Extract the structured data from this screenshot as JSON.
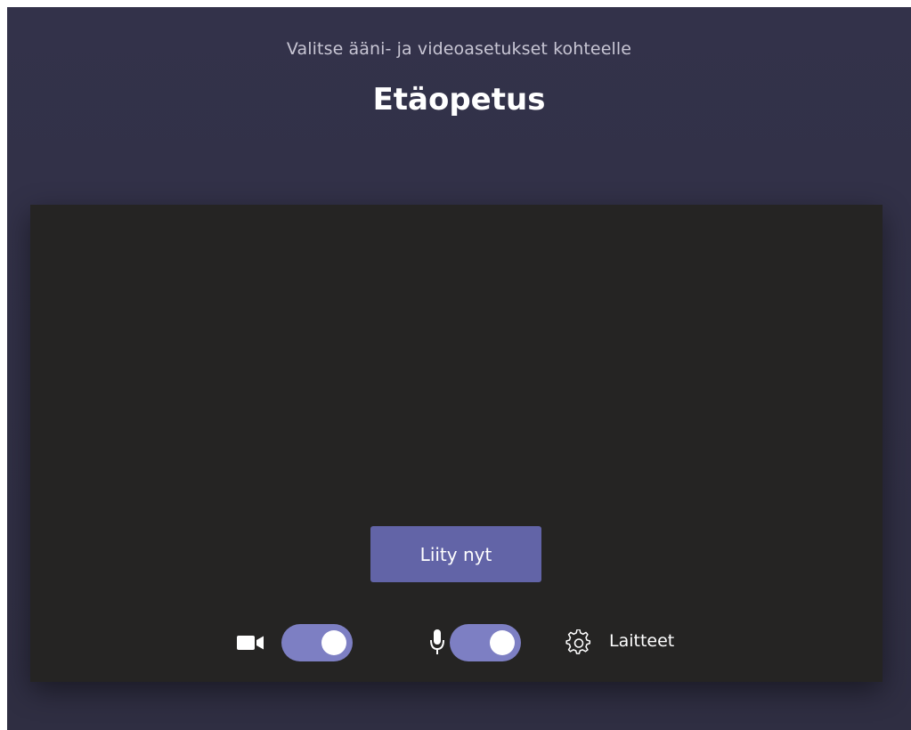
{
  "header": {
    "subtitle": "Valitse ääni- ja videoasetukset kohteelle",
    "meeting_title": "Etäopetus"
  },
  "preview": {
    "join_label": "Liity nyt"
  },
  "controls": {
    "camera": {
      "icon": "video-camera-icon",
      "toggle_on": true
    },
    "microphone": {
      "icon": "microphone-icon",
      "toggle_on": true
    },
    "devices": {
      "icon": "gear-icon",
      "label": "Laitteet"
    }
  },
  "colors": {
    "background": "#33324a",
    "preview_background": "#252423",
    "accent": "#6264a7",
    "toggle_on": "#7d7fc3"
  }
}
